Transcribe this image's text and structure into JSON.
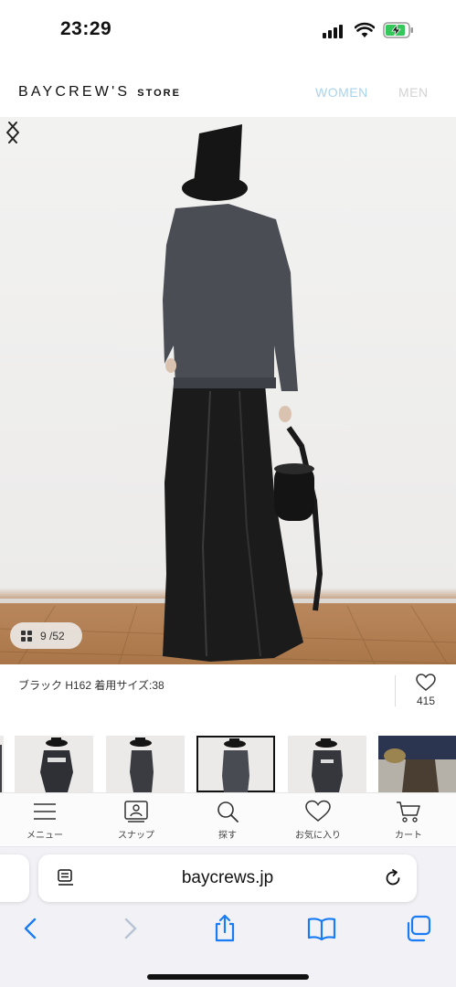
{
  "status_bar": {
    "time": "23:29"
  },
  "header": {
    "logo": "BAYCREW'S",
    "logo_sub": "STORE",
    "nav": [
      {
        "label": "WOMEN",
        "active": true
      },
      {
        "label": "MEN",
        "active": false
      }
    ]
  },
  "gallery": {
    "counter": "9 /52",
    "caption": "ブラック H162 着用サイズ:38",
    "favorite_count": "415",
    "thumbnail_count_visible": 6,
    "selected_thumbnail": 3
  },
  "bottom_nav": [
    {
      "label": "メニュー",
      "icon": "menu-icon"
    },
    {
      "label": "スナップ",
      "icon": "snap-icon"
    },
    {
      "label": "探す",
      "icon": "search-icon"
    },
    {
      "label": "お気に入り",
      "icon": "heart-icon"
    },
    {
      "label": "カート",
      "icon": "cart-icon"
    }
  ],
  "browser": {
    "url": "baycrews.jp",
    "toolbar": [
      "back-icon",
      "forward-icon",
      "share-icon",
      "bookmarks-icon",
      "tabs-icon"
    ]
  },
  "colors": {
    "accent_women": "#a9d3ee",
    "inactive_men": "#d3d3d3",
    "ios_blue": "#1a7cf5",
    "floor": "#b07d50"
  }
}
